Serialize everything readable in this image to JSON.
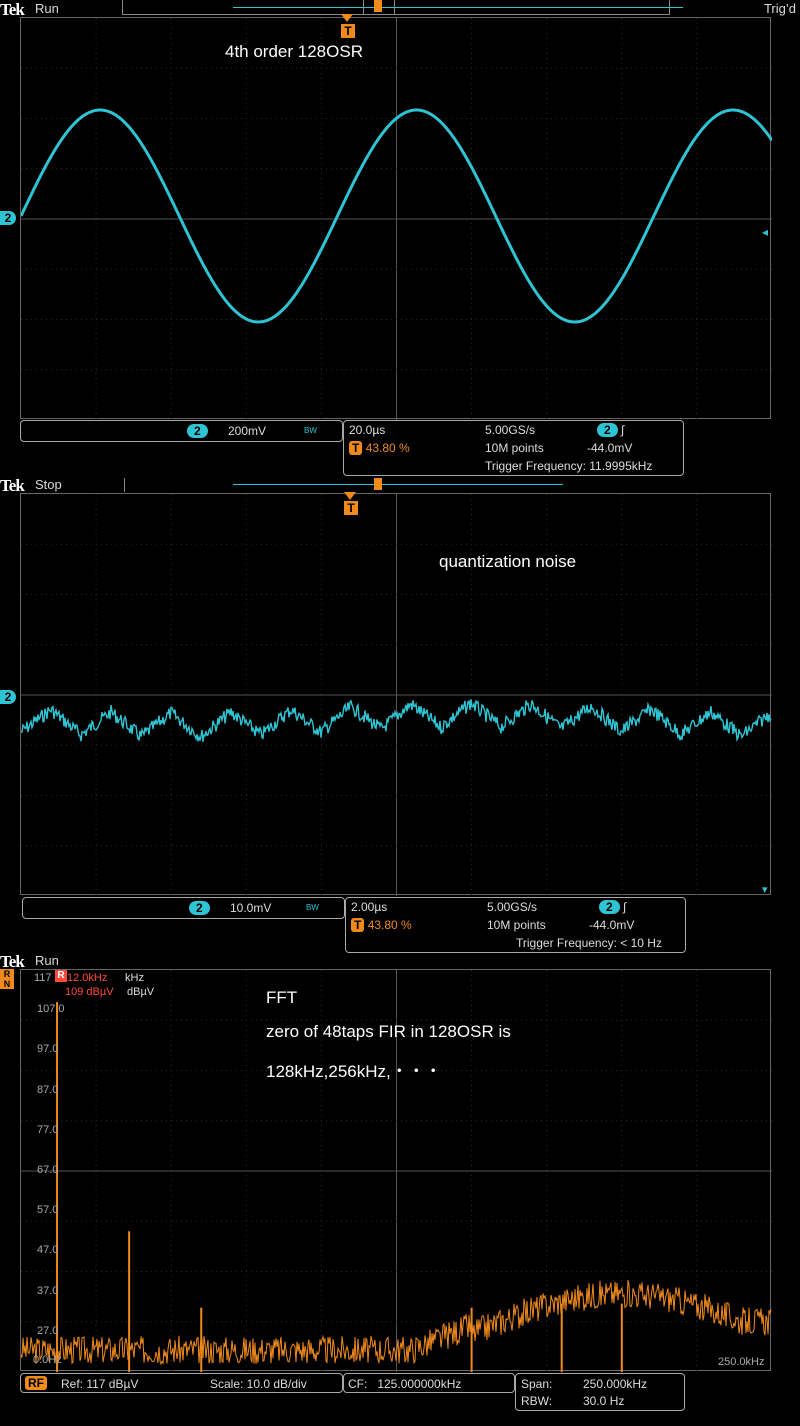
{
  "p1": {
    "brand": "Tek",
    "status": "Run",
    "trigger_state": "Trig’d",
    "annotation": "4th order 128OSR",
    "channel": "2",
    "scale": "200mV",
    "bw": "BW",
    "timebase": "20.0µs",
    "trig_pos": "43.80 %",
    "sample_rate": "5.00GS/s",
    "points": "10M points",
    "trig_level": "-44.0mV",
    "trig_freq": "Trigger Frequency: 11.9995kHz"
  },
  "p2": {
    "brand": "Tek",
    "status": "Stop",
    "annotation": "quantization noise",
    "channel": "2",
    "scale": "10.0mV",
    "bw": "BW",
    "timebase": "2.00µs",
    "trig_pos": "43.80 %",
    "sample_rate": "5.00GS/s",
    "points": "10M points",
    "trig_level": "-44.0mV",
    "trig_freq": "Trigger Frequency: < 10 Hz"
  },
  "p3": {
    "brand": "Tek",
    "status": "Run",
    "annotation_lines": [
      "FFT",
      "zero of 48taps FIR in 128OSR is",
      "128kHz,256kHz,・・・"
    ],
    "marker_freq": "12.0kHz",
    "marker_freq_unit": "kHz",
    "marker_level": "109 dBµV",
    "marker_level_unit": "dBµV",
    "top_level": "117",
    "y_labels": [
      "107.0",
      "97.0",
      "87.0",
      "77.0",
      "67.0",
      "57.0",
      "47.0",
      "37.0",
      "27.0"
    ],
    "x_start": "0.0Hz",
    "x_end": "250.0kHz",
    "rf": "RF",
    "ref": "Ref: 117 dBµV",
    "scale": "Scale: 10.0 dB/div",
    "cf": "CF:   125.000000kHz",
    "span_label": "Span:",
    "span_value": "250.000kHz",
    "rbw_label": "RBW:",
    "rbw_value": "30.0 Hz"
  },
  "chart_data": [
    {
      "type": "line",
      "series": [
        {
          "values": [
            0.0,
            1.0,
            0.0,
            -1.0,
            0.0,
            1.0,
            0.0,
            -1.0,
            0.0,
            1.0,
            0.55
          ]
        }
      ],
      "x": [
        0,
        15.8,
        31.6,
        47.4,
        63.2,
        79.0,
        94.8,
        110.6,
        126.4,
        142.2,
        150.0
      ],
      "color": "#2ec4d4"
    },
    {
      "type": "line",
      "color": "#2ec4d4"
    },
    {
      "type": "bar",
      "x": [
        12,
        36,
        60,
        84,
        108,
        128,
        150,
        180,
        200,
        230
      ],
      "values": [
        109,
        52,
        33,
        23,
        24,
        28,
        33,
        34,
        34,
        24
      ],
      "ylim": [
        17,
        117
      ],
      "xlim": [
        0,
        250
      ],
      "color": "#f08a1c"
    }
  ]
}
